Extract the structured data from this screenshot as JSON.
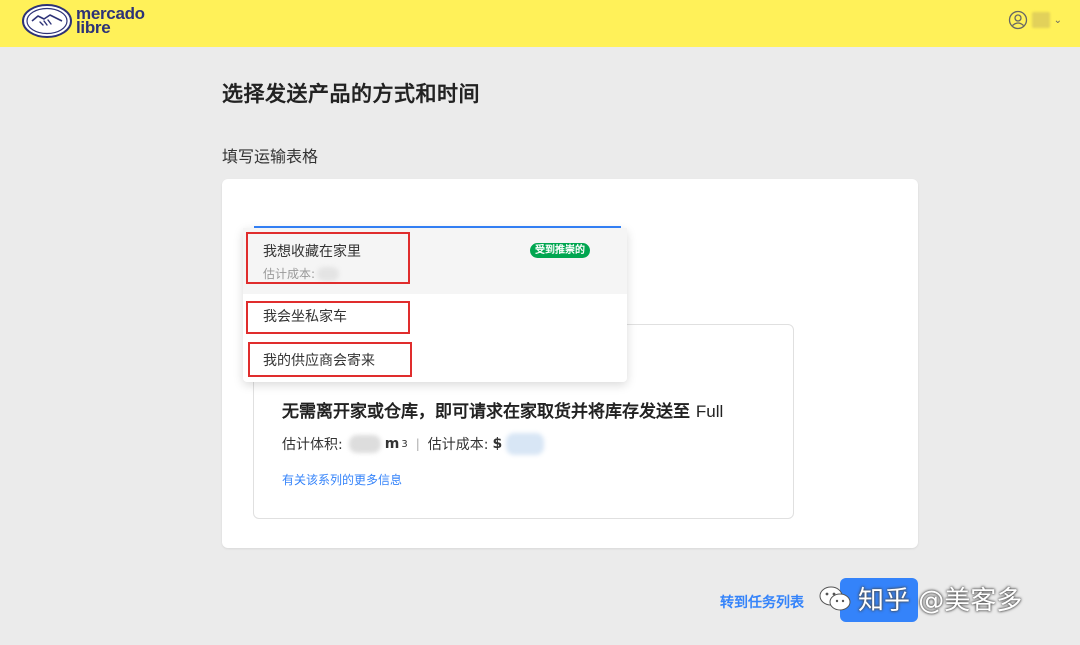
{
  "header": {
    "logo_line1": "mercado",
    "logo_line2": "libre",
    "brand_color": "#fff159",
    "account_icon": "user-circle-icon"
  },
  "page": {
    "title": "选择发送产品的方式和时间",
    "section_label": "填写运输表格"
  },
  "dropdown": {
    "options": [
      {
        "label": "我想收藏在家里",
        "sub_label": "估计成本:",
        "badge": "受到推崇的",
        "selected": true
      },
      {
        "label": "我会坐私家车"
      },
      {
        "label": "我的供应商会寄来"
      }
    ]
  },
  "option_card": {
    "heading": "无需离开家或仓库，即可请求在家取货并将库存发送至",
    "heading_suffix": "Full",
    "volume_label": "估计体积:",
    "volume_unit": "m",
    "volume_exp": "3",
    "separator": "|",
    "cost_label": "估计成本:",
    "currency": "$",
    "more_link": "有关该系列的更多信息"
  },
  "footer": {
    "link": "转到任务列表"
  },
  "watermark": {
    "text": "知乎 @美客多"
  },
  "colors": {
    "accent": "#3483fa",
    "badge": "#00a650",
    "highlight": "#e02d2d"
  }
}
